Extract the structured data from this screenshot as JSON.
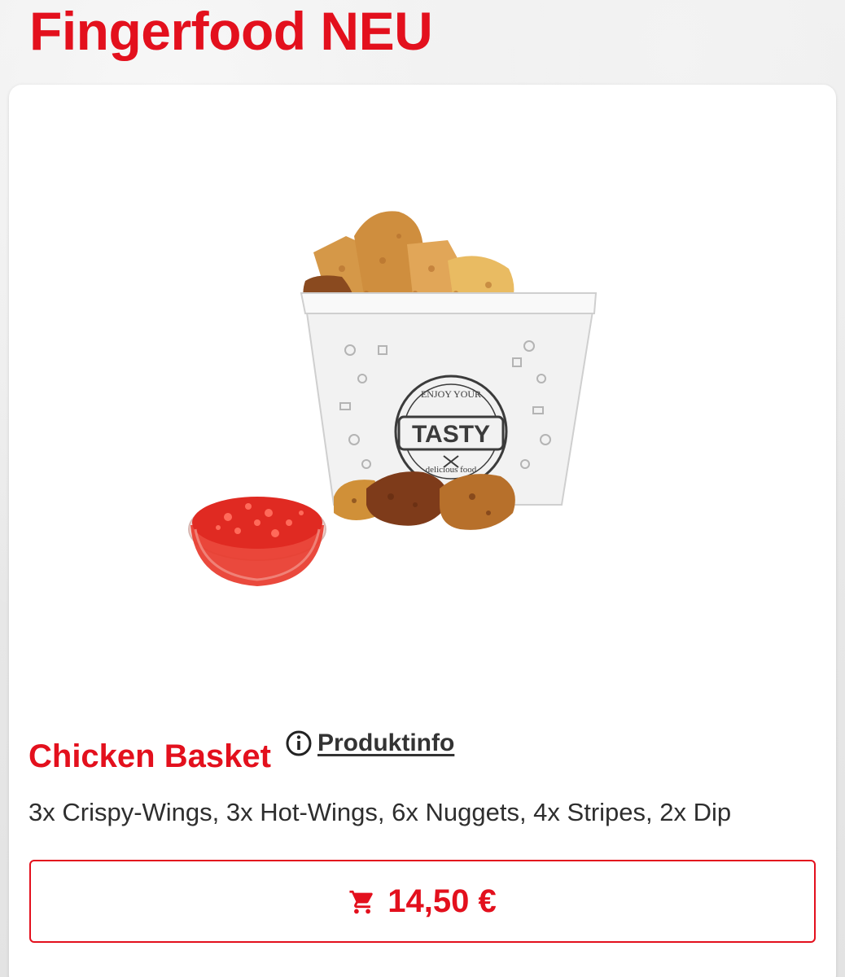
{
  "header": {
    "category_title": "Fingerfood NEU"
  },
  "product": {
    "name": "Chicken Basket",
    "info_link_label": "Produktinfo",
    "description": "3x Crispy-Wings, 3x Hot-Wings, 6x Nuggets, 4x Stripes, 2x Dip",
    "price": "14,50 €",
    "image": {
      "cup_text_top": "ENJOY YOUR",
      "cup_text_main": "TASTY",
      "cup_text_bottom": "delicious food"
    }
  },
  "icons": {
    "info": "info-circle-icon",
    "cart": "shopping-cart-icon"
  },
  "colors": {
    "accent": "#e3101d",
    "text": "#2e2e2e",
    "card": "#ffffff"
  }
}
